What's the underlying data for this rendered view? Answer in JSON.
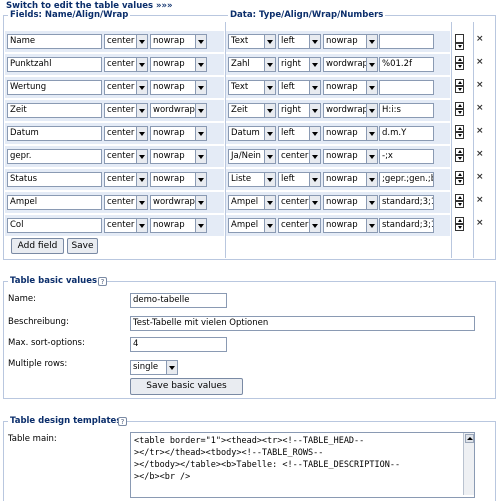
{
  "switch_link": "Switch to edit the table values »»»",
  "fields_section": {
    "fields_legend": "Fields: Name/Align/Wrap",
    "data_legend": "Data: Type/Align/Wrap/Numbers",
    "rows": [
      {
        "name": "Name",
        "align": "center",
        "wrap": "nowrap",
        "type": "Text",
        "dalign": "left",
        "dwrap": "nowrap",
        "numbers": ""
      },
      {
        "name": "Punktzahl",
        "align": "center",
        "wrap": "nowrap",
        "type": "Zahl",
        "dalign": "right",
        "dwrap": "wordwrap",
        "numbers": "%01.2f"
      },
      {
        "name": "Wertung",
        "align": "center",
        "wrap": "nowrap",
        "type": "Text",
        "dalign": "left",
        "dwrap": "nowrap",
        "numbers": ""
      },
      {
        "name": "Zeit",
        "align": "center",
        "wrap": "wordwrap",
        "type": "Zeit",
        "dalign": "right",
        "dwrap": "wordwrap",
        "numbers": "H:i:s"
      },
      {
        "name": "Datum",
        "align": "center",
        "wrap": "nowrap",
        "type": "Datum",
        "dalign": "left",
        "dwrap": "nowrap",
        "numbers": "d.m.Y"
      },
      {
        "name": "gepr.",
        "align": "center",
        "wrap": "nowrap",
        "type": "Ja/Nein",
        "dalign": "center",
        "dwrap": "nowrap",
        "numbers": "-;x"
      },
      {
        "name": "Status",
        "align": "center",
        "wrap": "nowrap",
        "type": "Liste",
        "dalign": "left",
        "dwrap": "nowrap",
        "numbers": ";gepr.;gen.;be"
      },
      {
        "name": "Ampel",
        "align": "center",
        "wrap": "wordwrap",
        "type": "Ampel",
        "dalign": "center",
        "dwrap": "nowrap",
        "numbers": "standard;3;1"
      },
      {
        "name": "Col",
        "align": "center",
        "wrap": "nowrap",
        "type": "Ampel",
        "dalign": "center",
        "dwrap": "nowrap",
        "numbers": "standard;3;1"
      }
    ],
    "add_field_label": "Add field",
    "save_label": "Save"
  },
  "basic": {
    "legend": "Table basic values",
    "name_label": "Name:",
    "name_value": "demo-tabelle",
    "desc_label": "Beschreibung:",
    "desc_value": "Test-Tabelle mit vielen Optionen",
    "sort_label": "Max. sort-options:",
    "sort_value": "4",
    "multi_label": "Multiple rows:",
    "multi_value": "single",
    "save_label": "Save basic values"
  },
  "design": {
    "legend": "Table design templates",
    "main_label": "Table main:",
    "main_value": "<table border=\"1\"><thead><tr><!--TABLE_HEAD--\n></tr></thead><tbody><!--TABLE_ROWS--\n></tbody></table><b>Tabelle: <!--TABLE_DESCRIPTION--\n></b><br />"
  },
  "help_symbol": "?",
  "delete_symbol": "×"
}
